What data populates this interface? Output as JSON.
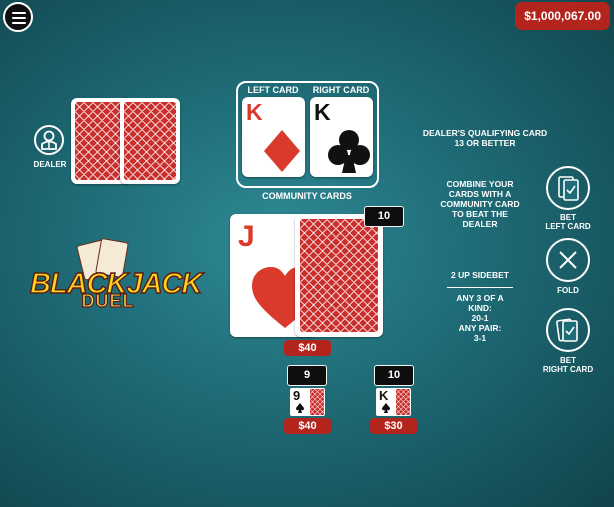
{
  "balance": "$1,000,067.00",
  "dealer": {
    "label": "DEALER"
  },
  "community": {
    "left_label": "LEFT CARD",
    "right_label": "RIGHT CARD",
    "title": "COMMUNITY CARDS",
    "left_card": {
      "rank": "K",
      "suit": "diamonds"
    },
    "right_card": {
      "rank": "K",
      "suit": "clubs"
    }
  },
  "player": {
    "card_rank": "J",
    "card_suit": "hearts",
    "count": "10",
    "bet": "$40"
  },
  "sidebets": [
    {
      "count": "9",
      "rank": "9",
      "bet": "$40"
    },
    {
      "count": "10",
      "rank": "K",
      "bet": "$30"
    }
  ],
  "info": {
    "qualify_line1": "DEALER'S QUALIFYING CARD",
    "qualify_line2": "13 OR BETTER",
    "combine_lines": [
      "COMBINE YOUR",
      "CARDS WITH A",
      "COMMUNITY CARD",
      "TO BEAT THE",
      "DEALER"
    ],
    "sidebet_title": "2 UP SIDEBET",
    "sidebet_lines": [
      "ANY 3 OF A KIND:",
      "20-1",
      "ANY PAIR:",
      "3-1"
    ]
  },
  "buttons": {
    "bet_left": [
      "BET",
      "LEFT CARD"
    ],
    "fold": "FOLD",
    "bet_right": [
      "BET",
      "RIGHT CARD"
    ]
  },
  "logo": {
    "line1": "BLACKJACK",
    "line2": "DUEL"
  },
  "colors": {
    "felt": "#1f6d78",
    "accent_red": "#b3241d",
    "card_red": "#d93a2b"
  }
}
